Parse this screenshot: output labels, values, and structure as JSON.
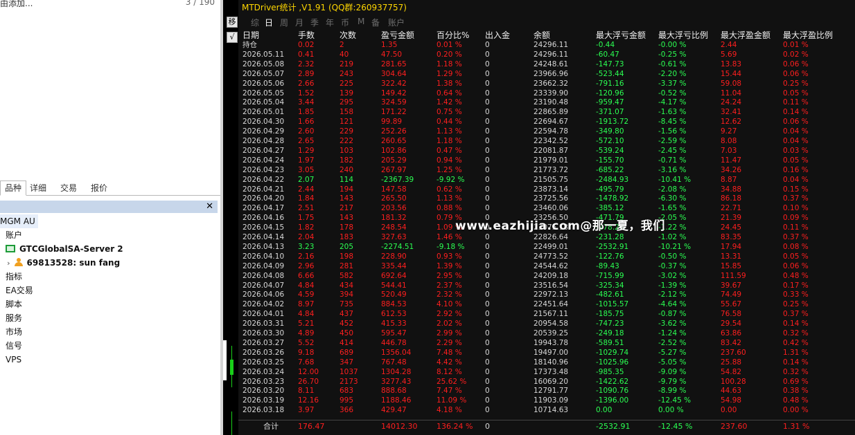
{
  "navigator": {
    "top_left_text": "由添加...",
    "top_right_count": "3 / 190",
    "tabs": [
      "品种",
      "详细",
      "交易",
      "报价"
    ],
    "tree": {
      "root": "MGM AU",
      "accounts": "账户",
      "server": "GTCGlobalSA-Server 2",
      "user": "69813528: sun fang",
      "items": [
        "指标",
        "EA交易",
        "脚本",
        "服务",
        "市场",
        "信号",
        "VPS"
      ]
    },
    "close_glyph": "✕"
  },
  "side_buttons": [
    "移",
    "√"
  ],
  "stats": {
    "title": "MTDriver统计 ,V1.91 (QQ群:260937757)",
    "periods": [
      "综",
      "日",
      "周",
      "月",
      "季",
      "年",
      "币",
      "M",
      "备",
      "账户"
    ],
    "active_period": "日",
    "headers": [
      "日期",
      "手数",
      "次数",
      "盈亏金额",
      "百分比%",
      "出入金",
      "余额",
      "最大浮亏金额",
      "最大浮亏比例",
      "最大浮盈金额",
      "最大浮盈比例"
    ],
    "rows": [
      [
        "持仓",
        "0.02",
        "2",
        "1.35",
        "0.01 %",
        "0",
        "24296.11",
        "-0.44",
        "-0.00 %",
        "2.44",
        "0.01 %"
      ],
      [
        "2026.05.11",
        "0.41",
        "40",
        "47.50",
        "0.20 %",
        "0",
        "24296.11",
        "-60.47",
        "-0.25 %",
        "5.69",
        "0.02 %"
      ],
      [
        "2026.05.08",
        "2.32",
        "219",
        "281.65",
        "1.18 %",
        "0",
        "24248.61",
        "-147.73",
        "-0.61 %",
        "13.83",
        "0.06 %"
      ],
      [
        "2026.05.07",
        "2.89",
        "243",
        "304.64",
        "1.29 %",
        "0",
        "23966.96",
        "-523.44",
        "-2.20 %",
        "15.44",
        "0.06 %"
      ],
      [
        "2026.05.06",
        "2.66",
        "225",
        "322.42",
        "1.38 %",
        "0",
        "23662.32",
        "-791.16",
        "-3.37 %",
        "59.08",
        "0.25 %"
      ],
      [
        "2026.05.05",
        "1.52",
        "139",
        "149.42",
        "0.64 %",
        "0",
        "23339.90",
        "-120.96",
        "-0.52 %",
        "11.04",
        "0.05 %"
      ],
      [
        "2026.05.04",
        "3.44",
        "295",
        "324.59",
        "1.42 %",
        "0",
        "23190.48",
        "-959.47",
        "-4.17 %",
        "24.24",
        "0.11 %"
      ],
      [
        "2026.05.01",
        "1.85",
        "158",
        "171.22",
        "0.75 %",
        "0",
        "22865.89",
        "-371.07",
        "-1.63 %",
        "32.41",
        "0.14 %"
      ],
      [
        "2026.04.30",
        "1.66",
        "121",
        "99.89",
        "0.44 %",
        "0",
        "22694.67",
        "-1913.72",
        "-8.45 %",
        "12.62",
        "0.06 %"
      ],
      [
        "2026.04.29",
        "2.60",
        "229",
        "252.26",
        "1.13 %",
        "0",
        "22594.78",
        "-349.80",
        "-1.56 %",
        "9.27",
        "0.04 %"
      ],
      [
        "2026.04.28",
        "2.65",
        "222",
        "260.65",
        "1.18 %",
        "0",
        "22342.52",
        "-572.10",
        "-2.59 %",
        "8.08",
        "0.04 %"
      ],
      [
        "2026.04.27",
        "1.29",
        "103",
        "102.86",
        "0.47 %",
        "0",
        "22081.87",
        "-539.24",
        "-2.45 %",
        "7.03",
        "0.03 %"
      ],
      [
        "2026.04.24",
        "1.97",
        "182",
        "205.29",
        "0.94 %",
        "0",
        "21979.01",
        "-155.70",
        "-0.71 %",
        "11.47",
        "0.05 %"
      ],
      [
        "2026.04.23",
        "3.05",
        "240",
        "267.97",
        "1.25 %",
        "0",
        "21773.72",
        "-685.22",
        "-3.16 %",
        "34.26",
        "0.16 %"
      ],
      [
        "2026.04.22",
        "2.07",
        "114",
        "-2367.39",
        "-9.92 %",
        "0",
        "21505.75",
        "-2484.93",
        "-10.41 %",
        "8.87",
        "0.04 %"
      ],
      [
        "2026.04.21",
        "2.44",
        "194",
        "147.58",
        "0.62 %",
        "0",
        "23873.14",
        "-495.79",
        "-2.08 %",
        "34.88",
        "0.15 %"
      ],
      [
        "2026.04.20",
        "1.84",
        "143",
        "265.50",
        "1.13 %",
        "0",
        "23725.56",
        "-1478.92",
        "-6.30 %",
        "86.18",
        "0.37 %"
      ],
      [
        "2026.04.17",
        "2.51",
        "217",
        "203.56",
        "0.88 %",
        "0",
        "23460.06",
        "-385.12",
        "-1.65 %",
        "22.71",
        "0.10 %"
      ],
      [
        "2026.04.16",
        "1.75",
        "143",
        "181.32",
        "0.79 %",
        "0",
        "23256.50",
        "-471.79",
        "-2.05 %",
        "21.39",
        "0.09 %"
      ],
      [
        "2026.04.15",
        "1.82",
        "178",
        "248.54",
        "1.09 %",
        "0",
        "23075.18",
        "-278.28",
        "-1.22 %",
        "24.45",
        "0.11 %"
      ],
      [
        "2026.04.14",
        "2.04",
        "183",
        "327.63",
        "1.46 %",
        "0",
        "22826.64",
        "-231.28",
        "-1.02 %",
        "83.35",
        "0.37 %"
      ],
      [
        "2026.04.13",
        "3.23",
        "205",
        "-2274.51",
        "-9.18 %",
        "0",
        "22499.01",
        "-2532.91",
        "-10.21 %",
        "17.94",
        "0.08 %"
      ],
      [
        "2026.04.10",
        "2.16",
        "198",
        "228.90",
        "0.93 %",
        "0",
        "24773.52",
        "-122.76",
        "-0.50 %",
        "13.31",
        "0.05 %"
      ],
      [
        "2026.04.09",
        "2.96",
        "281",
        "335.44",
        "1.39 %",
        "0",
        "24544.62",
        "-89.43",
        "-0.37 %",
        "15.85",
        "0.06 %"
      ],
      [
        "2026.04.08",
        "6.66",
        "582",
        "692.64",
        "2.95 %",
        "0",
        "24209.18",
        "-715.99",
        "-3.02 %",
        "111.59",
        "0.48 %"
      ],
      [
        "2026.04.07",
        "4.84",
        "434",
        "544.41",
        "2.37 %",
        "0",
        "23516.54",
        "-325.34",
        "-1.39 %",
        "39.67",
        "0.17 %"
      ],
      [
        "2026.04.06",
        "4.59",
        "394",
        "520.49",
        "2.32 %",
        "0",
        "22972.13",
        "-482.61",
        "-2.12 %",
        "74.49",
        "0.33 %"
      ],
      [
        "2026.04.02",
        "8.97",
        "735",
        "884.53",
        "4.10 %",
        "0",
        "22451.64",
        "-1015.57",
        "-4.64 %",
        "55.67",
        "0.25 %"
      ],
      [
        "2026.04.01",
        "4.84",
        "437",
        "612.53",
        "2.92 %",
        "0",
        "21567.11",
        "-185.75",
        "-0.87 %",
        "76.58",
        "0.37 %"
      ],
      [
        "2026.03.31",
        "5.21",
        "452",
        "415.33",
        "2.02 %",
        "0",
        "20954.58",
        "-747.23",
        "-3.62 %",
        "29.54",
        "0.14 %"
      ],
      [
        "2026.03.30",
        "4.89",
        "450",
        "595.47",
        "2.99 %",
        "0",
        "20539.25",
        "-249.18",
        "-1.24 %",
        "63.86",
        "0.32 %"
      ],
      [
        "2026.03.27",
        "5.52",
        "414",
        "446.78",
        "2.29 %",
        "0",
        "19943.78",
        "-589.51",
        "-2.52 %",
        "83.42",
        "0.42 %"
      ],
      [
        "2026.03.26",
        "9.18",
        "689",
        "1356.04",
        "7.48 %",
        "0",
        "19497.00",
        "-1029.74",
        "-5.27 %",
        "237.60",
        "1.31 %"
      ],
      [
        "2026.03.25",
        "7.68",
        "347",
        "767.48",
        "4.42 %",
        "0",
        "18140.96",
        "-1025.96",
        "-5.05 %",
        "25.88",
        "0.14 %"
      ],
      [
        "2026.03.24",
        "12.00",
        "1037",
        "1304.28",
        "8.12 %",
        "0",
        "17373.48",
        "-985.35",
        "-9.09 %",
        "54.82",
        "0.32 %"
      ],
      [
        "2026.03.23",
        "26.70",
        "2173",
        "3277.43",
        "25.62 %",
        "0",
        "16069.20",
        "-1422.62",
        "-9.79 %",
        "100.28",
        "0.69 %"
      ],
      [
        "2026.03.20",
        "8.11",
        "683",
        "888.68",
        "7.47 %",
        "0",
        "12791.77",
        "-1090.76",
        "-8.99 %",
        "44.63",
        "0.38 %"
      ],
      [
        "2026.03.19",
        "12.16",
        "995",
        "1188.46",
        "11.09 %",
        "0",
        "11903.09",
        "-1396.00",
        "-12.45 %",
        "54.98",
        "0.48 %"
      ],
      [
        "2026.03.18",
        "3.97",
        "366",
        "429.47",
        "4.18 %",
        "0",
        "10714.63",
        "0.00",
        "0.00 %",
        "0.00",
        "0.00 %"
      ]
    ],
    "total": {
      "label": "合计",
      "lots": "176.47",
      "pnl": "14012.30",
      "pct": "136.24 %",
      "deposit": "0",
      "max_loss": "-2532.91",
      "max_loss_pct": "-12.45 %",
      "max_gain": "237.60",
      "max_gain_pct": "1.31 %"
    },
    "colors": {
      "loss_text": "#ff1f1f",
      "gain_text": "#2bff52",
      "title": "#ffd700"
    }
  },
  "watermark": "www.eazhijia.com@那一夏，我们"
}
